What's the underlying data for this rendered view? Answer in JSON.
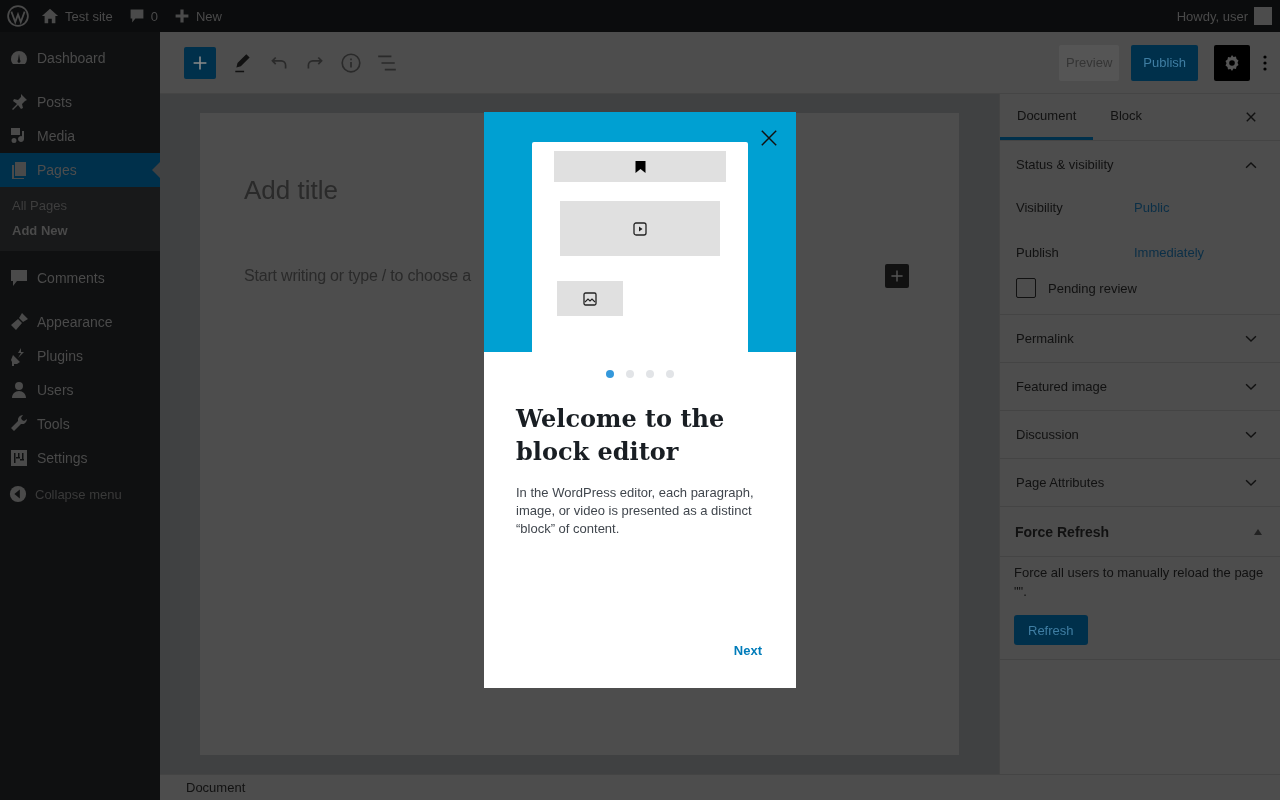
{
  "admin_bar": {
    "site": "Test site",
    "comments": "0",
    "new": "New",
    "greeting": "Howdy, user"
  },
  "admin_menu": [
    {
      "label": "Dashboard",
      "selected": false
    },
    {
      "label": "Posts",
      "selected": false
    },
    {
      "label": "Media",
      "selected": false
    },
    {
      "label": "Pages",
      "selected": true,
      "children": [
        {
          "label": "All Pages",
          "selected": false
        },
        {
          "label": "Add New",
          "selected": true
        }
      ]
    },
    {
      "label": "Comments",
      "selected": false
    },
    {
      "label": "Appearance",
      "selected": false
    },
    {
      "label": "Plugins",
      "selected": false
    },
    {
      "label": "Users",
      "selected": false
    },
    {
      "label": "Tools",
      "selected": false
    },
    {
      "label": "Settings",
      "selected": false
    }
  ],
  "collapse_menu": "Collapse menu",
  "toolbar": {
    "preview": "Preview",
    "publish": "Publish"
  },
  "editor": {
    "title_placeholder": "Add title",
    "body_placeholder": "Start writing or type / to choose a"
  },
  "settings_sidebar": {
    "tabs": [
      {
        "label": "Document",
        "selected": true
      },
      {
        "label": "Block",
        "selected": false
      }
    ],
    "status": {
      "title": "Status & visibility",
      "expanded": true,
      "fields": [
        {
          "label": "Visibility",
          "value": "Public"
        },
        {
          "label": "Publish",
          "value": "Immediately"
        }
      ],
      "pending_review": {
        "label": "Pending review",
        "checked": false
      }
    },
    "panels": [
      {
        "title": "Permalink",
        "expanded": false
      },
      {
        "title": "Featured image",
        "expanded": false
      },
      {
        "title": "Discussion",
        "expanded": false
      },
      {
        "title": "Page Attributes",
        "expanded": false
      }
    ],
    "force_refresh": {
      "title": "Force Refresh",
      "expanded": true,
      "text": "Force all users to manually reload the page \"\".",
      "button": "Refresh"
    }
  },
  "status_bar": "Document",
  "welcome_modal": {
    "pages": [
      {
        "selected": true
      },
      {
        "selected": false
      },
      {
        "selected": false
      },
      {
        "selected": false
      }
    ],
    "title": "Welcome to the block editor",
    "text": "In the WordPress editor, each paragraph, image, or video is presented as a distinct “block” of content.",
    "next": "Next"
  }
}
